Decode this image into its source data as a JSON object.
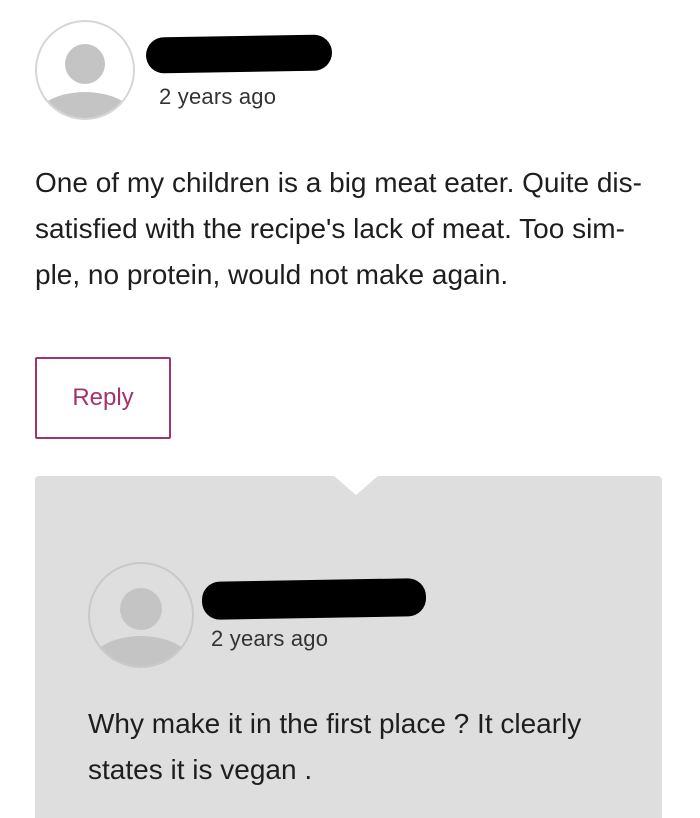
{
  "comment": {
    "author_redacted": true,
    "timestamp": "2 years ago",
    "lines": [
      "One of my children is a big meat eater. Quite dis-",
      "satisfied with the recipe's lack of meat. Too sim-",
      "ple, no protein, would not make again."
    ],
    "reply_label": "Reply"
  },
  "reply": {
    "author_redacted": true,
    "timestamp": "2 years ago",
    "lines": [
      "Why make it in the first place ? It clearly",
      "states it is vegan ."
    ]
  },
  "colors": {
    "accent": "#a3336c",
    "panel_bg": "#dedede",
    "avatar_fill": "#c4c4c4"
  },
  "icons": {
    "avatar": "user-avatar-icon"
  }
}
